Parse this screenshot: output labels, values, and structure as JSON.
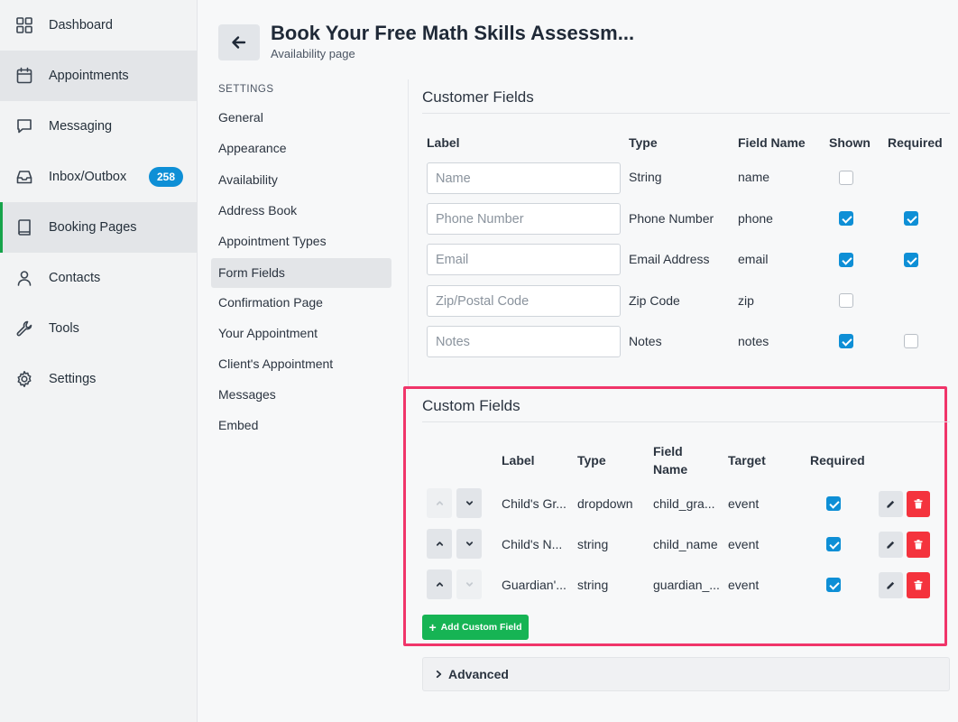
{
  "nav": {
    "items": [
      {
        "label": "Dashboard",
        "icon": "grid-icon"
      },
      {
        "label": "Appointments",
        "icon": "calendar-icon"
      },
      {
        "label": "Messaging",
        "icon": "chat-icon"
      },
      {
        "label": "Inbox/Outbox",
        "icon": "inbox-icon",
        "badge": "258"
      },
      {
        "label": "Booking Pages",
        "icon": "book-icon"
      },
      {
        "label": "Contacts",
        "icon": "user-icon"
      },
      {
        "label": "Tools",
        "icon": "wrench-icon"
      },
      {
        "label": "Settings",
        "icon": "gear-icon"
      }
    ],
    "badge_color": "#0e8fd6",
    "active_accent": "#16a34a"
  },
  "header": {
    "title": "Book Your Free Math Skills Assessm...",
    "subtitle": "Availability page"
  },
  "settings": {
    "heading": "SETTINGS",
    "items": [
      "General",
      "Appearance",
      "Availability",
      "Address Book",
      "Appointment Types",
      "Form Fields",
      "Confirmation Page",
      "Your Appointment",
      "Client's Appointment",
      "Messages",
      "Embed"
    ],
    "selected": "Form Fields"
  },
  "customer_fields": {
    "title": "Customer Fields",
    "headers": {
      "label": "Label",
      "type": "Type",
      "field_name": "Field Name",
      "shown": "Shown",
      "required": "Required"
    },
    "rows": [
      {
        "placeholder": "Name",
        "type": "String",
        "field_name": "name",
        "shown": false,
        "required": null
      },
      {
        "placeholder": "Phone Number",
        "type": "Phone Number",
        "field_name": "phone",
        "shown": true,
        "required": true
      },
      {
        "placeholder": "Email",
        "type": "Email Address",
        "field_name": "email",
        "shown": true,
        "required": true
      },
      {
        "placeholder": "Zip/Postal Code",
        "type": "Zip Code",
        "field_name": "zip",
        "shown": false,
        "required": null
      },
      {
        "placeholder": "Notes",
        "type": "Notes",
        "field_name": "notes",
        "shown": true,
        "required": false
      }
    ]
  },
  "custom_fields": {
    "title": "Custom Fields",
    "headers": {
      "label": "Label",
      "type": "Type",
      "field_name_line1": "Field",
      "field_name_line2": "Name",
      "target": "Target",
      "required": "Required"
    },
    "rows": [
      {
        "label": "Child's Gr...",
        "type": "dropdown",
        "field_name": "child_gra...",
        "target": "event",
        "required": true,
        "up_disabled": true,
        "down_disabled": false
      },
      {
        "label": "Child's N...",
        "type": "string",
        "field_name": "child_name",
        "target": "event",
        "required": true,
        "up_disabled": false,
        "down_disabled": false
      },
      {
        "label": "Guardian'...",
        "type": "string",
        "field_name": "guardian_...",
        "target": "event",
        "required": true,
        "up_disabled": false,
        "down_disabled": true
      }
    ],
    "add_label": "Add Custom Field",
    "highlight_color": "#f0356a"
  },
  "advanced": {
    "label": "Advanced"
  }
}
